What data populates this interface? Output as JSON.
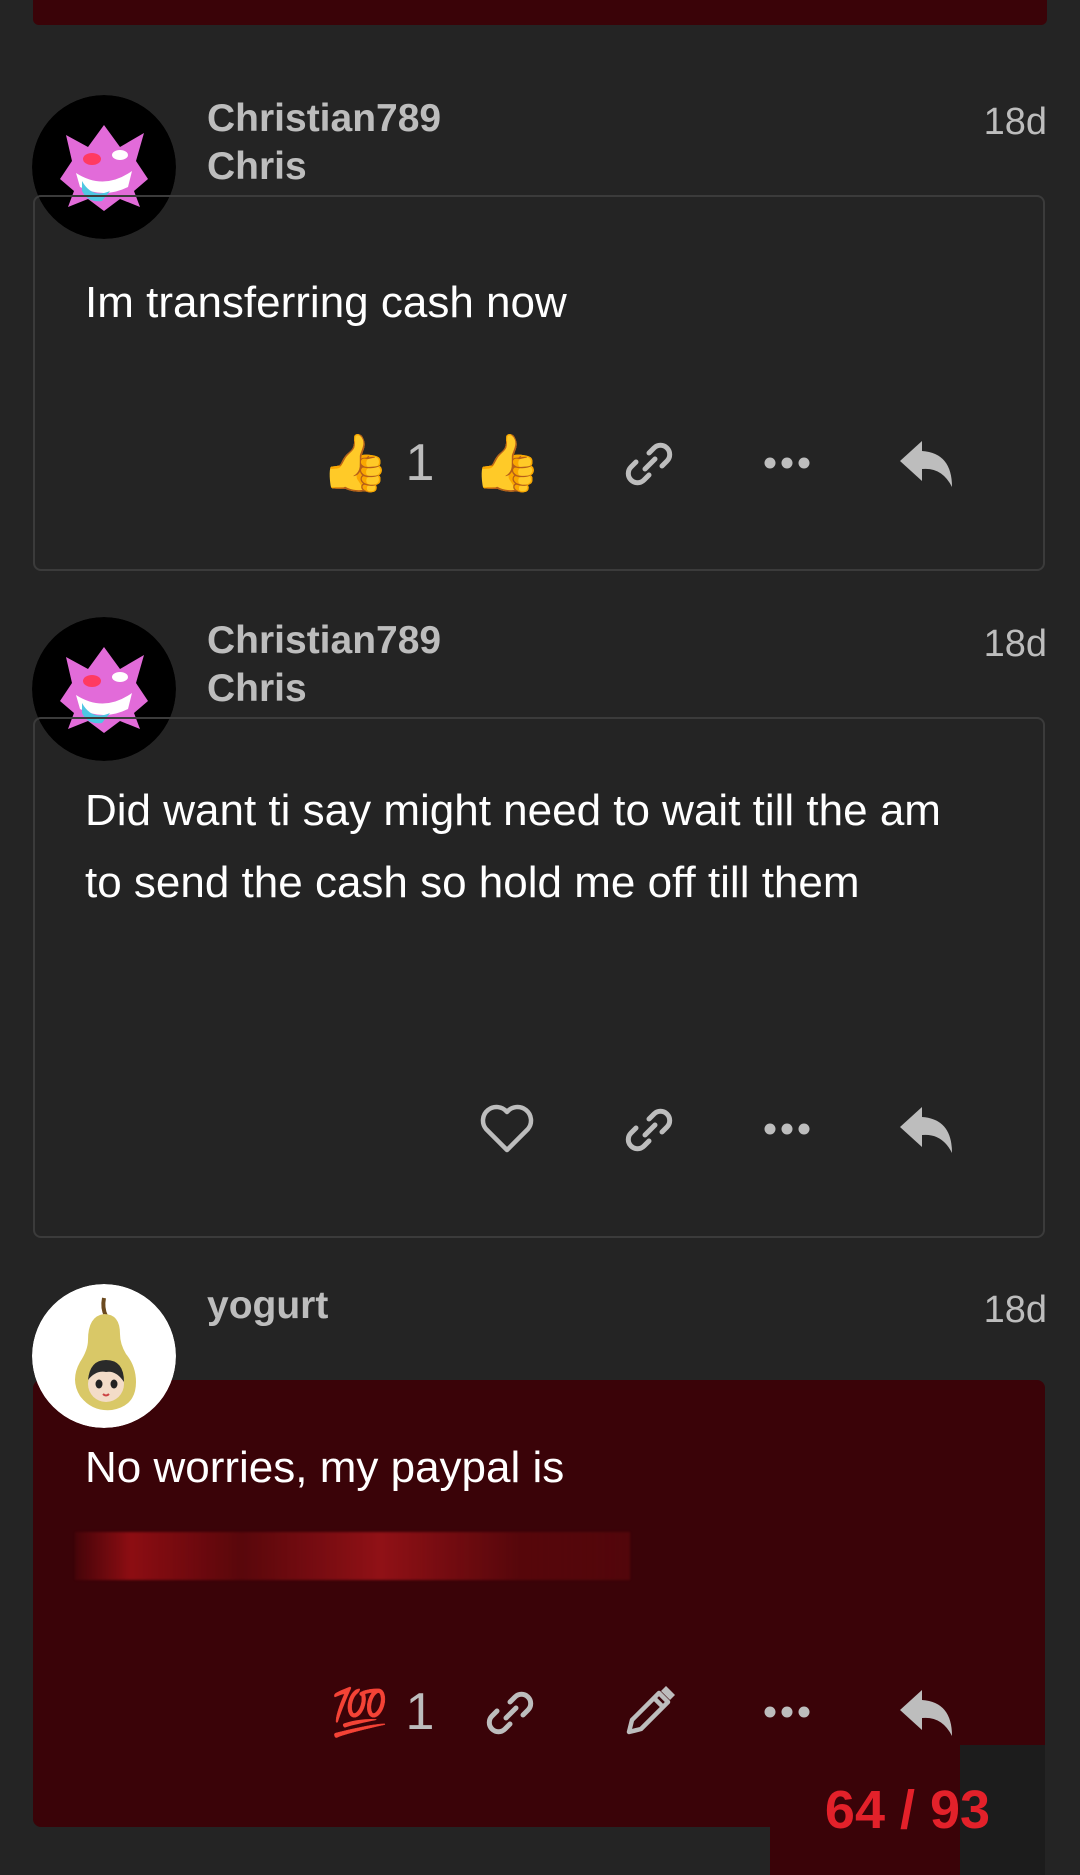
{
  "posts": [
    {
      "username": "Christian789",
      "display_name": "Chris",
      "age": "18d",
      "body": "Im transferring cash now",
      "reactions": {
        "emoji": "👍",
        "count": "1"
      },
      "avatar": "gengar-avatar"
    },
    {
      "username": "Christian789",
      "display_name": "Chris",
      "age": "18d",
      "body": "Did want ti say might need to wait till the am to send the cash so hold me off till them",
      "avatar": "gengar-avatar"
    },
    {
      "username": "yogurt",
      "display_name": "",
      "age": "18d",
      "body": "No worries, my paypal is",
      "reactions": {
        "emoji": "💯",
        "count": "1"
      },
      "avatar": "pear-avatar"
    }
  ],
  "progress": {
    "label": "64 / 93"
  },
  "colors": {
    "background": "#242424",
    "highlight": "#3a0308",
    "accent": "#e3212a",
    "muted_text": "#bdbdbd"
  },
  "icons": [
    "thumbs-up-icon",
    "heart-icon",
    "link-icon",
    "more-icon",
    "reply-icon",
    "hundred-icon",
    "edit-icon"
  ]
}
